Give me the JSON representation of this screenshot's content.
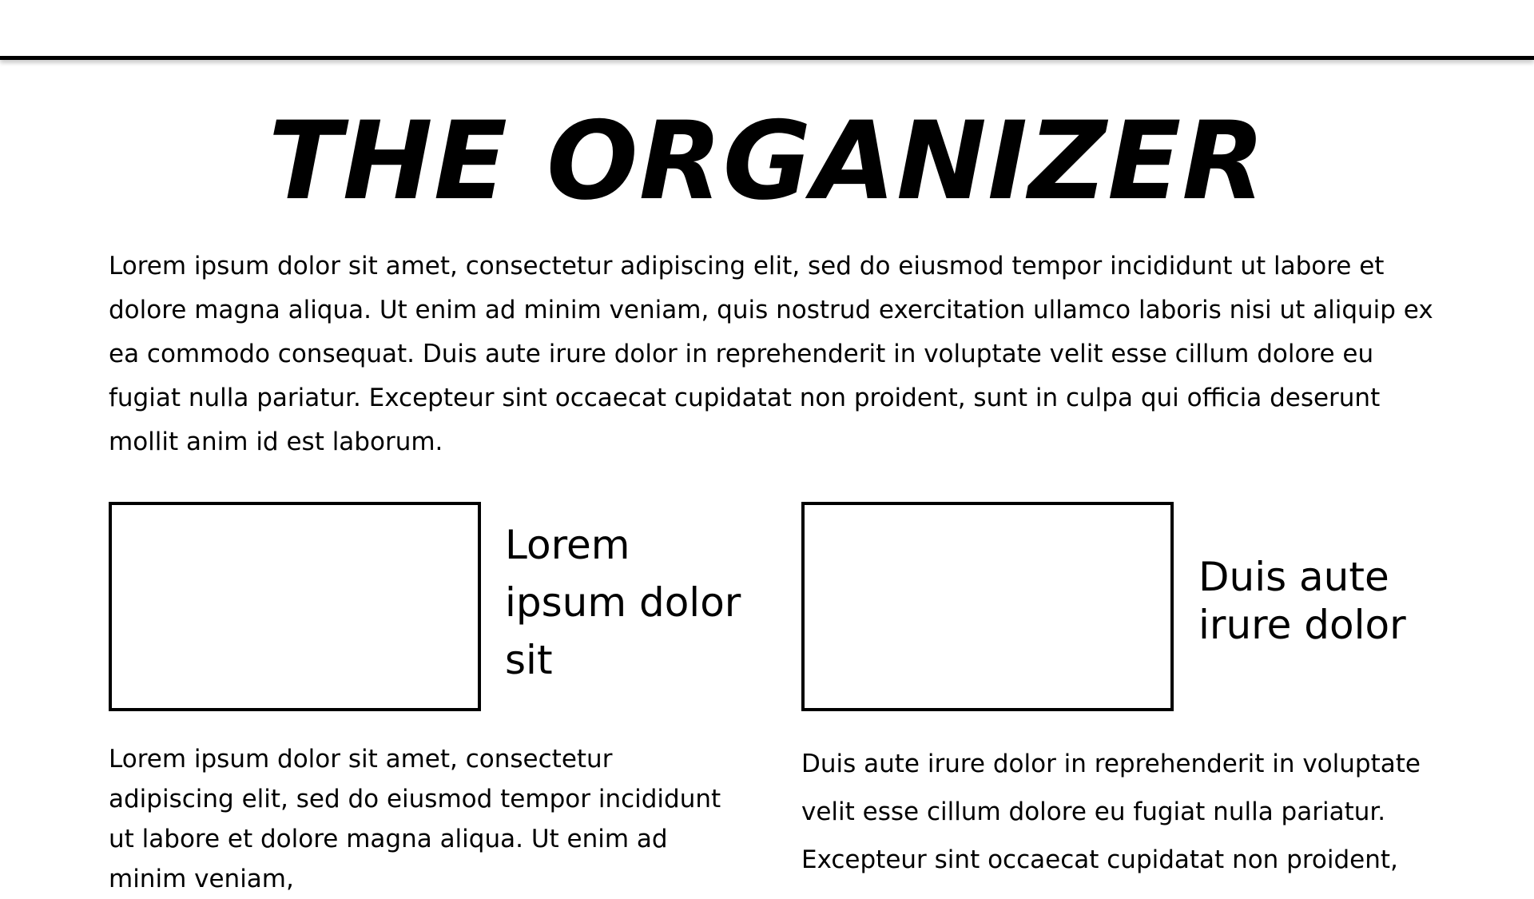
{
  "document": {
    "title": "THE ORGANIZER",
    "intro": "Lorem ipsum dolor sit amet, consectetur adipiscing elit, sed do eiusmod tempor incididunt ut labore et dolore magna aliqua. Ut enim ad minim veniam, quis nostrud exercitation ullamco laboris nisi ut aliquip ex ea commodo consequat. Duis aute irure dolor in reprehenderit in voluptate velit esse cillum dolore eu fugiat nulla pariatur. Excepteur sint occaecat cupidatat non proident, sunt in culpa qui officia deserunt mollit anim id est laborum.",
    "columns": [
      {
        "caption": "Lorem ipsum dolor sit",
        "body": "Lorem ipsum dolor sit amet, consectetur adipiscing elit, sed do eiusmod tempor incididunt ut labore et dolore magna aliqua. Ut enim ad minim veniam,"
      },
      {
        "caption": "Duis aute irure dolor",
        "body": "Duis aute irure dolor in reprehenderit in voluptate velit esse cillum dolore eu fugiat nulla pariatur. Excepteur sint occaecat cupidatat non proident,"
      }
    ]
  }
}
